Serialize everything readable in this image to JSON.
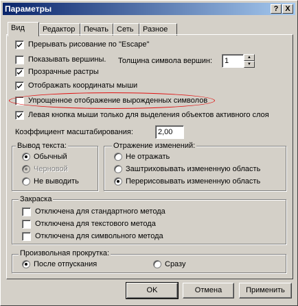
{
  "window": {
    "title": "Параметры",
    "help_btn": "?",
    "close_btn": "X"
  },
  "tabs": [
    "Вид",
    "Редактор",
    "Печать",
    "Сеть",
    "Разное"
  ],
  "options": {
    "escape": "Прерывать рисование по \"Escape\"",
    "vertices": "Показывать вершины.",
    "vertex_size_label": "Толщина символа вершин:",
    "vertex_size_value": "1",
    "transparent": "Прозрачные растры",
    "coords": "Отображать координаты мыши",
    "simplified": "Упрощенное отображение вырожденных символов",
    "left_button": "Левая кнопка мыши только для выделения объектов активного слоя",
    "scale_label": "Коэффициент масштабирования:",
    "scale_value": "2,00"
  },
  "text_output": {
    "title": "Вывод текста:",
    "normal": "Обычный",
    "draft": "Черновой",
    "none": "Не выводить"
  },
  "changes": {
    "title": "Отражение изменений:",
    "none": "Не отражать",
    "hatch": "Заштриховывать измененную область",
    "redraw": "Перерисовывать измененную область"
  },
  "fill": {
    "title": "Закраска",
    "standard": "Отключена для стандартного метода",
    "text": "Отключена для текстового метода",
    "symbol": "Отключена для символьного метода"
  },
  "scroll": {
    "title": "Произвольная прокрутка:",
    "after": "После отпускания",
    "immediate": "Сразу"
  },
  "buttons": {
    "ok": "OK",
    "cancel": "Отмена",
    "apply": "Применить"
  }
}
